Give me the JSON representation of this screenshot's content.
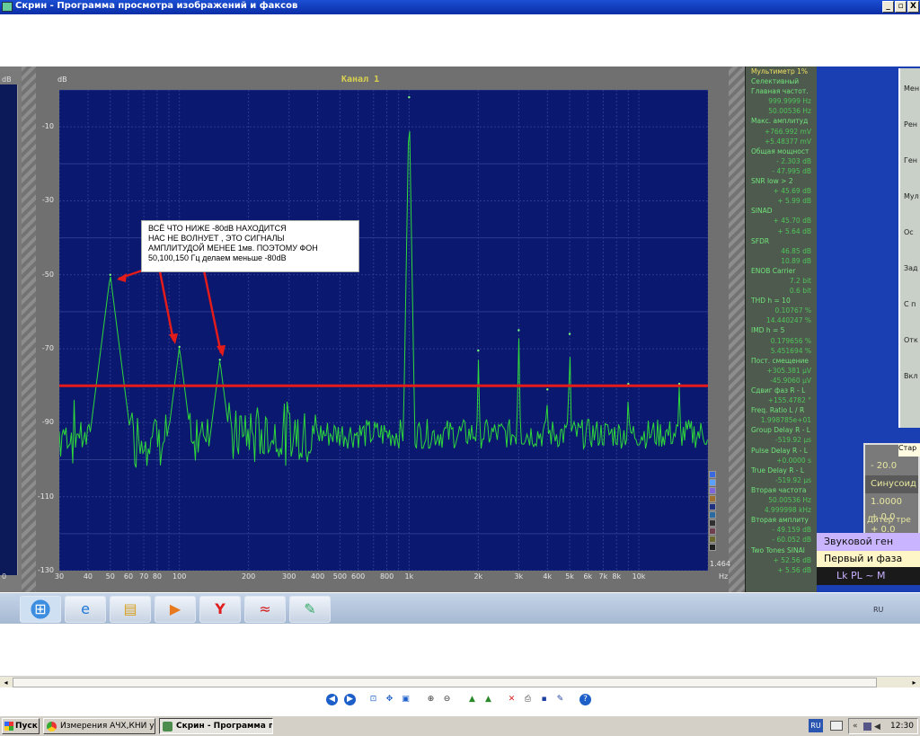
{
  "window": {
    "title": "Скрин - Программа просмотра изображений и факсов",
    "buttons": [
      "_",
      "▫",
      "X"
    ]
  },
  "analyzer": {
    "channel_title": "Канал 1",
    "y_unit": "dB",
    "x_unit": "Hz",
    "y_ticks": [
      "-10",
      "-30",
      "-50",
      "-70",
      "-90",
      "-110",
      "-130"
    ],
    "x_ticks": [
      "30",
      "40",
      "50",
      "60",
      "70",
      "80",
      "100",
      "200",
      "300",
      "400",
      "500",
      "600",
      "800",
      "1k",
      "2k",
      "3k",
      "4k",
      "5k",
      "6k",
      "7k",
      "8k",
      "10k"
    ],
    "scale_value": "1.464",
    "annotation": [
      "ВСЁ  ЧТО  НИЖЕ  -80dB НАХОДИТСЯ",
      "НАС  НЕ  ВОЛНУЕТ , ЭТО  СИГНАЛЫ",
      "АМПЛИТУДОЙ  МЕНЕЕ 1мв.  ПОЭТОМУ  ФОН",
      "50,100,150 Гц  делаем  меньше  -80dB"
    ],
    "left_edge_labels": [
      "dB",
      "0"
    ]
  },
  "chart_data": {
    "type": "line",
    "xscale": "log",
    "xlabel": "Hz",
    "ylabel": "dB",
    "xlim": [
      30,
      20000
    ],
    "ylim": [
      -130,
      0
    ],
    "threshold": -80,
    "series": [
      {
        "peaks": [
          {
            "x": 50,
            "y": -50
          },
          {
            "x": 100,
            "y": -69.5
          },
          {
            "x": 150,
            "y": -73
          },
          {
            "x": 1000,
            "y": -2
          },
          {
            "x": 2000,
            "y": -70.5
          },
          {
            "x": 3000,
            "y": -65
          },
          {
            "x": 4000,
            "y": -81
          },
          {
            "x": 5000,
            "y": -66
          },
          {
            "x": 9000,
            "y": -79.5
          },
          {
            "x": 15000,
            "y": -79.5
          }
        ],
        "noise_floor": -93
      }
    ]
  },
  "multimeter": {
    "title": "Мультиметр 1%",
    "rows": [
      {
        "t": "lbl",
        "v": "Селективный"
      },
      {
        "t": "lbl",
        "v": "Главная частот."
      },
      {
        "t": "val",
        "v": "999.9999  Hz"
      },
      {
        "t": "val",
        "v": "50.00536  Hz"
      },
      {
        "t": "lbl",
        "v": "Макс. амплитуд"
      },
      {
        "t": "val",
        "v": "+766.992 mV"
      },
      {
        "t": "val",
        "v": "+5.48377 mV"
      },
      {
        "t": "lbl",
        "v": "Общая мощност"
      },
      {
        "t": "val",
        "v": "- 2.303 dB"
      },
      {
        "t": "val",
        "v": "- 47.995 dB"
      },
      {
        "t": "lbl",
        "v": "SNR      low > 2"
      },
      {
        "t": "val",
        "v": "+ 45.69 dB"
      },
      {
        "t": "val",
        "v": "+ 5.99 dB"
      },
      {
        "t": "lbl",
        "v": "SINAD"
      },
      {
        "t": "val",
        "v": "+ 45.70 dB"
      },
      {
        "t": "val",
        "v": "+ 5.64 dB"
      },
      {
        "t": "lbl",
        "v": "SFDR"
      },
      {
        "t": "val",
        "v": "46.85 dB"
      },
      {
        "t": "val",
        "v": "10.89 dB"
      },
      {
        "t": "lbl",
        "v": "ENOB  Carrier"
      },
      {
        "t": "val",
        "v": "7.2 bit"
      },
      {
        "t": "val",
        "v": "0.6 bit"
      },
      {
        "t": "lbl",
        "v": "THD       h = 10"
      },
      {
        "t": "val",
        "v": "0.10767 %"
      },
      {
        "t": "val",
        "v": "14.440247 %"
      },
      {
        "t": "lbl",
        "v": "IMD       h = 5"
      },
      {
        "t": "val",
        "v": "0.179656 %"
      },
      {
        "t": "val",
        "v": "5.451694 %"
      },
      {
        "t": "lbl",
        "v": "Пост. смещение"
      },
      {
        "t": "val",
        "v": "+305.381 µV"
      },
      {
        "t": "val",
        "v": "-45.9060 µV"
      },
      {
        "t": "lbl",
        "v": "Сдвиг фаз R - L"
      },
      {
        "t": "val",
        "v": "+155.4782 °"
      },
      {
        "t": "lbl",
        "v": "Freq. Ratio  L / R"
      },
      {
        "t": "val",
        "v": "1.998785e+01"
      },
      {
        "t": "lbl",
        "v": "Group Delay R - L"
      },
      {
        "t": "val",
        "v": "-519.92 µs"
      },
      {
        "t": "lbl",
        "v": "Pulse Delay R - L"
      },
      {
        "t": "val",
        "v": "+0.0000  s"
      },
      {
        "t": "lbl",
        "v": "True Delay R - L"
      },
      {
        "t": "val",
        "v": "-519.92 µs"
      },
      {
        "t": "lbl",
        "v": "Вторая частота"
      },
      {
        "t": "val",
        "v": "50.00536  Hz"
      },
      {
        "t": "val",
        "v": "4.999998 kHz"
      },
      {
        "t": "lbl",
        "v": "Вторая амплиту"
      },
      {
        "t": "val",
        "v": "- 49.159 dB"
      },
      {
        "t": "val",
        "v": "- 60.052 dB"
      },
      {
        "t": "lbl",
        "v": "Two Tones SINAl"
      },
      {
        "t": "val",
        "v": "+ 52.56 dB"
      },
      {
        "t": "val",
        "v": "+ 5.56 dB"
      }
    ]
  },
  "generator": {
    "tab": "Стар",
    "rows": [
      "- 20.0",
      "Синусоид",
      "1.0000",
      "+ 0.0",
      "+ 0.0",
      "Дитер тре"
    ],
    "title": "Звуковой ген",
    "subtitle": "Первый и фаза",
    "bar": "Lk PL  ~ M"
  },
  "right_side_labels": [
    "Мен",
    "Рен",
    "Ген",
    "Мул",
    "Ос",
    "Зад",
    "С п",
    "Отк",
    "Вкл"
  ],
  "win7_taskbar": {
    "icons": [
      "windows-orb",
      "ie",
      "folder",
      "media-player",
      "yandex",
      "audio-tool",
      "paint"
    ],
    "lang": "RU"
  },
  "viewer_toolbar": {
    "button_count": 16
  },
  "xp_taskbar": {
    "start": "Пуск",
    "tasks": [
      {
        "label": "Измерения АЧХ,КНИ ус...",
        "active": false
      },
      {
        "label": "Скрин - Программа п...",
        "active": true
      }
    ],
    "lang": "RU",
    "time": "12:30"
  }
}
